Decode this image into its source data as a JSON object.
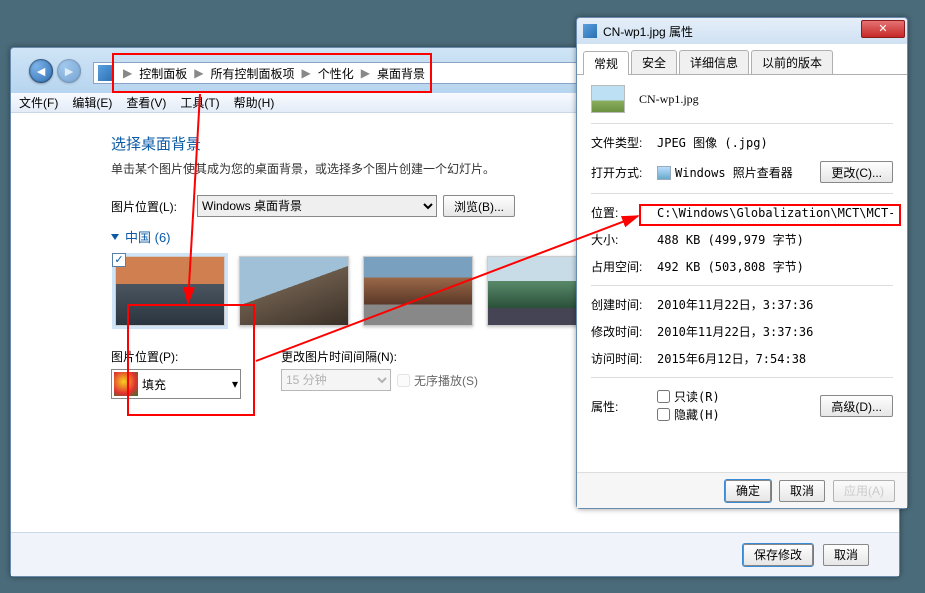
{
  "breadcrumb": {
    "p0": "控制面板",
    "p1": "所有控制面板项",
    "p2": "个性化",
    "p3": "桌面背景"
  },
  "menu": {
    "file": "文件(F)",
    "edit": "编辑(E)",
    "view": "查看(V)",
    "tools": "工具(T)",
    "help": "帮助(H)"
  },
  "page": {
    "title": "选择桌面背景",
    "subtitle": "单击某个图片使其成为您的桌面背景，或选择多个图片创建一个幻灯片。",
    "loc_label": "图片位置(L):",
    "loc_value": "Windows 桌面背景",
    "browse": "浏览(B)...",
    "group": "中国 (6)",
    "pos_label": "图片位置(P):",
    "fill": "填充",
    "interval_label": "更改图片时间间隔(N):",
    "interval_value": "15 分钟",
    "shuffle": "无序播放(S)",
    "save": "保存修改",
    "cancel": "取消"
  },
  "prop": {
    "title": "CN-wp1.jpg 属性",
    "tabs": {
      "t0": "常规",
      "t1": "安全",
      "t2": "详细信息",
      "t3": "以前的版本"
    },
    "filename": "CN-wp1.jpg",
    "kv": {
      "type_k": "文件类型:",
      "type_v": "JPEG 图像 (.jpg)",
      "open_k": "打开方式:",
      "open_v": "Windows 照片查看器",
      "open_btn": "更改(C)...",
      "loc_k": "位置:",
      "loc_v": "C:\\Windows\\Globalization\\MCT\\MCT-CN\\Wallp",
      "size_k": "大小:",
      "size_v": "488 KB (499,979 字节)",
      "disk_k": "占用空间:",
      "disk_v": "492 KB (503,808 字节)",
      "ctime_k": "创建时间:",
      "ctime_v": "2010年11月22日，3:37:36",
      "mtime_k": "修改时间:",
      "mtime_v": "2010年11月22日，3:37:36",
      "atime_k": "访问时间:",
      "atime_v": "2015年6月12日，7:54:38",
      "attr_k": "属性:",
      "ro": "只读(R)",
      "hid": "隐藏(H)",
      "adv": "高级(D)..."
    },
    "ok": "确定",
    "cancel": "取消",
    "apply": "应用(A)"
  }
}
